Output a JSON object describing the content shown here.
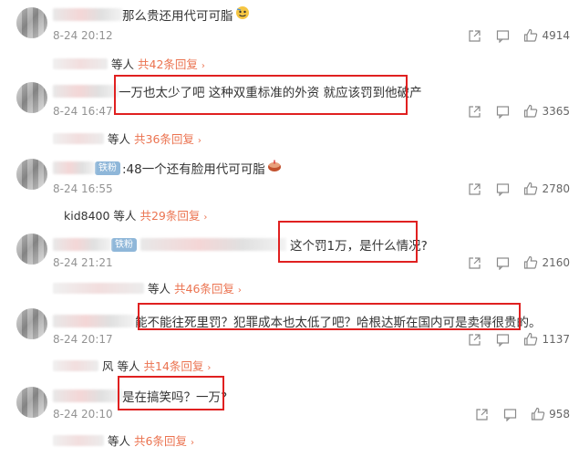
{
  "comments": [
    {
      "text": "那么贵还用代可可脂",
      "time": "8-24 20:12",
      "likes": "4914",
      "reply_user": "等人",
      "reply_count": "共42条回复",
      "has_ironfan": false
    },
    {
      "text": "一万也太少了吧 这种双重标准的外资 就应该罚到他破产",
      "time": "8-24 16:47",
      "likes": "3365",
      "reply_user": "等人",
      "reply_count": "共36条回复",
      "has_ironfan": false
    },
    {
      "text": ":48一个还有脸用代可可脂",
      "time": "8-24 16:55",
      "likes": "2780",
      "reply_user": "kid8400 等人",
      "reply_count": "共29条回复",
      "has_ironfan": true
    },
    {
      "text": "这个罚1万，是什么情况?",
      "time": "8-24 21:21",
      "likes": "2160",
      "reply_user": "等人",
      "reply_count": "共46条回复",
      "has_ironfan": true
    },
    {
      "text": "能不能往死里罚？犯罪成本也太低了吧？哈根达斯在国内可是卖得很贵的。",
      "time": "8-24 20:17",
      "likes": "1137",
      "reply_user": "等人",
      "reply_count": "共14条回复",
      "has_ironfan": false
    },
    {
      "text": "是在搞笑吗？一万?",
      "time": "8-24 20:10",
      "likes": "958",
      "reply_user": "等人",
      "reply_count": "共6条回复",
      "has_ironfan": false
    }
  ],
  "ironfan_label": "铁粉",
  "reply_name_fragment": "风",
  "icons": [
    "share-icon",
    "comment-icon",
    "like-icon",
    "emoji-icon",
    "cake-emoji-icon"
  ],
  "colors": {
    "reply_link": "#eb7350",
    "highlight_box": "#e02020",
    "time": "#939393"
  }
}
